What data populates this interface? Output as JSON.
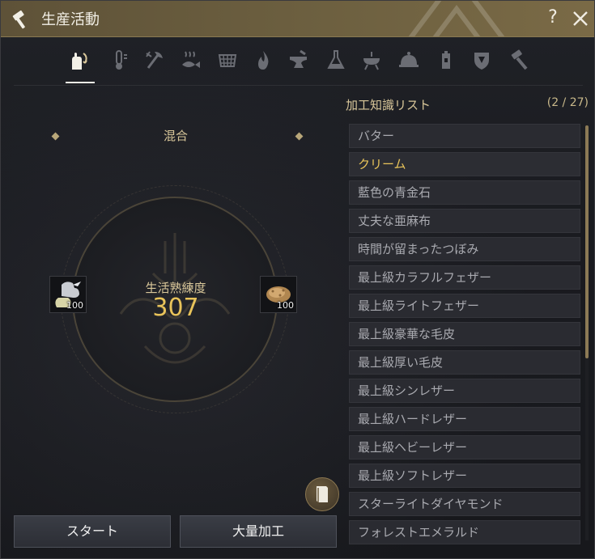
{
  "window": {
    "title": "生産活動",
    "help_label": "?",
    "icon": "hammer-icon"
  },
  "tabs": [
    {
      "name": "tab-mixing",
      "icon": "mixing-hand-icon",
      "active": true
    },
    {
      "name": "tab-gathering",
      "icon": "thermometer-icon",
      "active": false
    },
    {
      "name": "tab-lumbering",
      "icon": "axe-icon",
      "active": false
    },
    {
      "name": "tab-fishing",
      "icon": "fish-icon",
      "active": false
    },
    {
      "name": "tab-hunting",
      "icon": "net-icon",
      "active": false
    },
    {
      "name": "tab-heating",
      "icon": "flame-icon",
      "active": false
    },
    {
      "name": "tab-smithing",
      "icon": "anvil-icon",
      "active": false
    },
    {
      "name": "tab-alchemy",
      "icon": "flask-icon",
      "active": false
    },
    {
      "name": "tab-grilling",
      "icon": "grill-icon",
      "active": false
    },
    {
      "name": "tab-cooking",
      "icon": "cloche-icon",
      "active": false
    },
    {
      "name": "tab-building",
      "icon": "tower-icon",
      "active": false
    },
    {
      "name": "tab-guild",
      "icon": "crest-icon",
      "active": false
    },
    {
      "name": "tab-tools",
      "icon": "hammer-icon",
      "active": false
    }
  ],
  "process": {
    "mode_title": "混合",
    "mastery_label": "生活熟練度",
    "mastery_value": "307",
    "left_slot": {
      "icon": "pitcher-icon",
      "quantity": "100"
    },
    "right_slot": {
      "icon": "bread-icon",
      "quantity": "100"
    },
    "start_label": "スタート",
    "bulk_label": "大量加工",
    "book_icon": "book-icon"
  },
  "knowledge_list": {
    "header": "加工知識リスト",
    "count": "(2 / 27)",
    "selected_index": 1,
    "items": [
      "バター",
      "クリーム",
      "藍色の青金石",
      "丈夫な亜麻布",
      "時間が留まったつぼみ",
      "最上級カラフルフェザー",
      "最上級ライトフェザー",
      "最上級豪華な毛皮",
      "最上級厚い毛皮",
      "最上級シンレザー",
      "最上級ハードレザー",
      "最上級ヘビーレザー",
      "最上級ソフトレザー",
      "スターライトダイヤモンド",
      "フォレストエメラルド"
    ],
    "scroll_position": 0.0
  },
  "colors": {
    "accent_gold": "#e8c35a",
    "title_bar": "#6d6040",
    "label_gold": "#d9c79a"
  }
}
